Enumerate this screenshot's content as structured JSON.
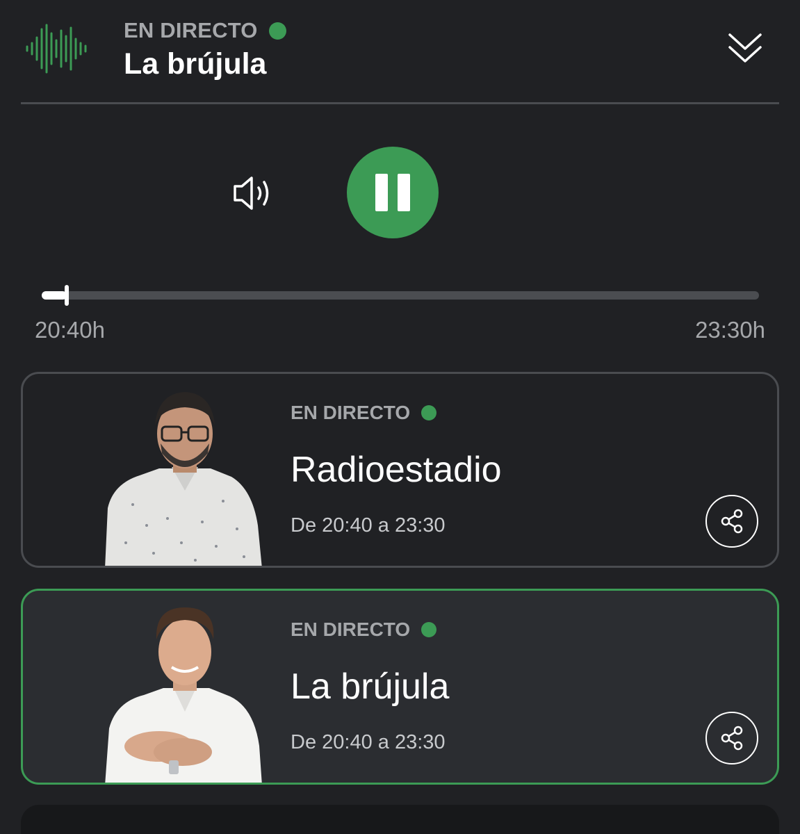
{
  "colors": {
    "accent": "#3c9b55",
    "background": "#202124",
    "active_card_bg": "#2b2d31"
  },
  "header": {
    "live_label": "EN DIRECTO",
    "title": "La brújula",
    "logo_icon": "sound-wave-icon",
    "collapse_icon": "double-chevron-down-icon"
  },
  "player": {
    "volume_icon": "speaker-volume-icon",
    "state": "playing",
    "pause_icon": "pause-icon",
    "progress_fraction": 0.035,
    "start_time": "20:40h",
    "end_time": "23:30h"
  },
  "programs": [
    {
      "live_label": "EN DIRECTO",
      "title": "Radioestadio",
      "schedule": "De 20:40 a 23:30",
      "active": false,
      "share_icon": "share-icon"
    },
    {
      "live_label": "EN DIRECTO",
      "title": "La brújula",
      "schedule": "De 20:40 a 23:30",
      "active": true,
      "share_icon": "share-icon"
    }
  ]
}
